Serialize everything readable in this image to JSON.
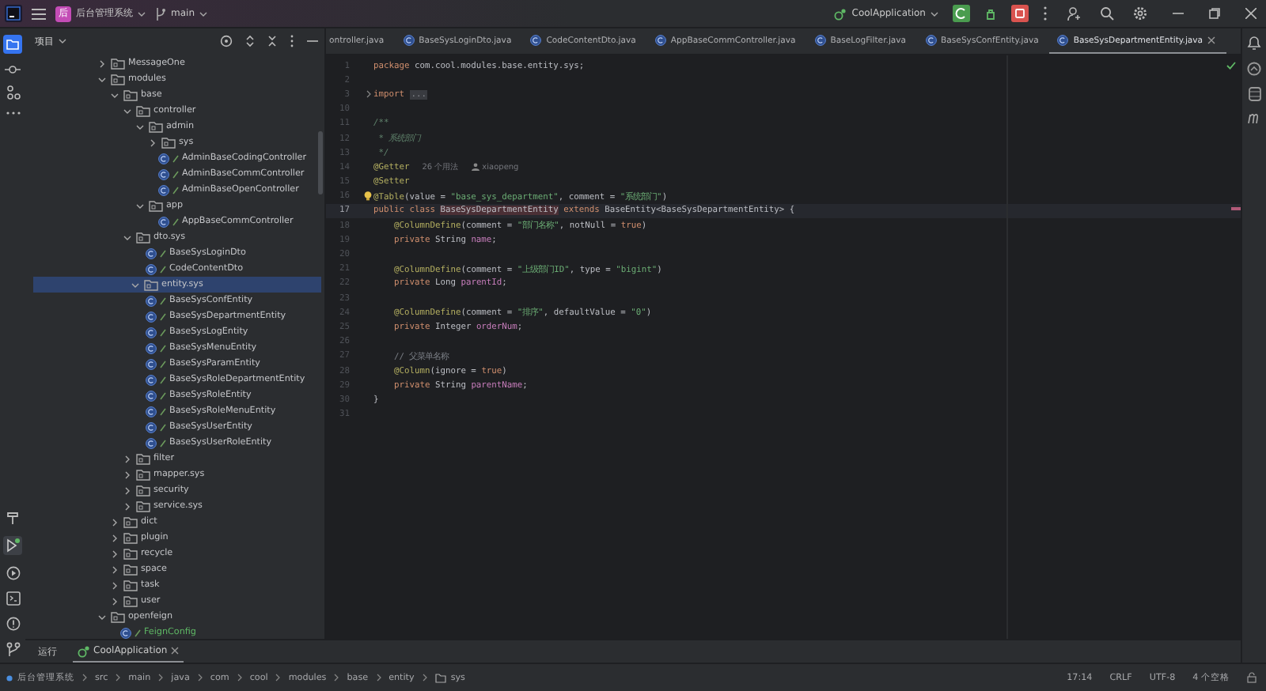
{
  "title_bar": {
    "project": "后台管理系统",
    "project_badge": "后",
    "branch": "main",
    "run_config": "CoolApplication"
  },
  "project_panel": {
    "title": "项目",
    "tree": [
      {
        "label": "MessageOne",
        "kind": "folder",
        "expanded": false,
        "selected": false
      },
      {
        "label": "modules",
        "kind": "folder",
        "expanded": true,
        "selected": false,
        "children": [
          {
            "label": "base",
            "kind": "folder",
            "expanded": true,
            "selected": false,
            "children": [
              {
                "label": "controller",
                "kind": "folder",
                "expanded": true,
                "selected": false,
                "children": [
                  {
                    "label": "admin",
                    "kind": "folder",
                    "expanded": true,
                    "selected": false,
                    "children": [
                      {
                        "label": "sys",
                        "kind": "folder",
                        "expanded": false,
                        "selected": false
                      },
                      {
                        "label": "AdminBaseCodingController",
                        "kind": "class",
                        "added": false,
                        "selected": false
                      },
                      {
                        "label": "AdminBaseCommController",
                        "kind": "class",
                        "added": false,
                        "selected": false
                      },
                      {
                        "label": "AdminBaseOpenController",
                        "kind": "class",
                        "added": false,
                        "selected": false
                      }
                    ]
                  },
                  {
                    "label": "app",
                    "kind": "folder",
                    "expanded": true,
                    "selected": false,
                    "children": [
                      {
                        "label": "AppBaseCommController",
                        "kind": "class",
                        "added": false,
                        "selected": false
                      }
                    ]
                  }
                ]
              },
              {
                "label": "dto.sys",
                "kind": "folder",
                "expanded": true,
                "selected": false,
                "children": [
                  {
                    "label": "BaseSysLoginDto",
                    "kind": "class",
                    "added": false,
                    "selected": false
                  },
                  {
                    "label": "CodeContentDto",
                    "kind": "class",
                    "added": false,
                    "selected": false
                  }
                ]
              },
              {
                "label": "entity.sys",
                "kind": "folder",
                "expanded": true,
                "selected": true,
                "children": [
                  {
                    "label": "BaseSysConfEntity",
                    "kind": "class",
                    "added": false,
                    "selected": false
                  },
                  {
                    "label": "BaseSysDepartmentEntity",
                    "kind": "class",
                    "added": false,
                    "selected": false
                  },
                  {
                    "label": "BaseSysLogEntity",
                    "kind": "class",
                    "added": false,
                    "selected": false
                  },
                  {
                    "label": "BaseSysMenuEntity",
                    "kind": "class",
                    "added": false,
                    "selected": false
                  },
                  {
                    "label": "BaseSysParamEntity",
                    "kind": "class",
                    "added": false,
                    "selected": false
                  },
                  {
                    "label": "BaseSysRoleDepartmentEntity",
                    "kind": "class",
                    "added": false,
                    "selected": false
                  },
                  {
                    "label": "BaseSysRoleEntity",
                    "kind": "class",
                    "added": false,
                    "selected": false
                  },
                  {
                    "label": "BaseSysRoleMenuEntity",
                    "kind": "class",
                    "added": false,
                    "selected": false
                  },
                  {
                    "label": "BaseSysUserEntity",
                    "kind": "class",
                    "added": false,
                    "selected": false
                  },
                  {
                    "label": "BaseSysUserRoleEntity",
                    "kind": "class",
                    "added": false,
                    "selected": false
                  }
                ]
              },
              {
                "label": "filter",
                "kind": "folder",
                "expanded": false,
                "selected": false
              },
              {
                "label": "mapper.sys",
                "kind": "folder",
                "expanded": false,
                "selected": false
              },
              {
                "label": "security",
                "kind": "folder",
                "expanded": false,
                "selected": false
              },
              {
                "label": "service.sys",
                "kind": "folder",
                "expanded": false,
                "selected": false
              }
            ]
          },
          {
            "label": "dict",
            "kind": "folder",
            "expanded": false,
            "selected": false
          },
          {
            "label": "plugin",
            "kind": "folder",
            "expanded": false,
            "selected": false
          },
          {
            "label": "recycle",
            "kind": "folder",
            "expanded": false,
            "selected": false
          },
          {
            "label": "space",
            "kind": "folder",
            "expanded": false,
            "selected": false
          },
          {
            "label": "task",
            "kind": "folder",
            "expanded": false,
            "selected": false
          },
          {
            "label": "user",
            "kind": "folder",
            "expanded": false,
            "selected": false
          }
        ]
      },
      {
        "label": "openfeign",
        "kind": "folder",
        "expanded": true,
        "selected": false,
        "children": [
          {
            "label": "FeignConfig",
            "kind": "class",
            "added": true,
            "selected": false
          }
        ]
      }
    ]
  },
  "editor_tabs": [
    {
      "label": "ontroller.java",
      "selected": false
    },
    {
      "label": "BaseSysLoginDto.java",
      "selected": false
    },
    {
      "label": "CodeContentDto.java",
      "selected": false
    },
    {
      "label": "AppBaseCommController.java",
      "selected": false
    },
    {
      "label": "BaseLogFilter.java",
      "selected": false
    },
    {
      "label": "BaseSysConfEntity.java",
      "selected": false
    },
    {
      "label": "BaseSysDepartmentEntity.java",
      "selected": true
    }
  ],
  "code": [
    {
      "number": "1",
      "current": false,
      "folded": false,
      "bulb": false,
      "indented": false,
      "tokens": [
        {
          "kind": "kw",
          "text": "package"
        },
        {
          "kind": "plain",
          "text": " com.cool.modules.base.entity.sys;"
        }
      ]
    },
    {
      "number": "2",
      "current": false,
      "folded": false,
      "bulb": false
    },
    {
      "number": "3",
      "current": false,
      "folded": true,
      "bulb": false,
      "indented": false,
      "tokens": [
        {
          "kind": "kw",
          "text": "import "
        },
        {
          "kind": "fold",
          "text": "..."
        }
      ]
    },
    {
      "number": "10",
      "current": false,
      "folded": false,
      "bulb": false
    },
    {
      "number": "11",
      "current": false,
      "folded": false,
      "bulb": false,
      "indented": false,
      "tokens": [
        {
          "kind": "doc",
          "text": "/**"
        }
      ]
    },
    {
      "number": "12",
      "current": false,
      "folded": false,
      "bulb": false,
      "indented": false,
      "tokens": [
        {
          "kind": "doc",
          "text": " * 系统部门"
        }
      ]
    },
    {
      "number": "13",
      "current": false,
      "folded": false,
      "bulb": false,
      "indented": false,
      "tokens": [
        {
          "kind": "doc",
          "text": " */"
        }
      ]
    },
    {
      "number": "14",
      "current": false,
      "folded": false,
      "bulb": false,
      "indented": false,
      "tokens": [
        {
          "kind": "ann",
          "text": "@Getter"
        }
      ],
      "hints": [
        {
          "kind": "usages",
          "text": "26 个用法"
        },
        {
          "kind": "author",
          "text": "xiaopeng"
        }
      ]
    },
    {
      "number": "15",
      "current": false,
      "folded": false,
      "bulb": false,
      "indented": false,
      "tokens": [
        {
          "kind": "ann",
          "text": "@Setter"
        }
      ]
    },
    {
      "number": "16",
      "current": false,
      "folded": false,
      "bulb": true,
      "indented": false,
      "tokens": [
        {
          "kind": "ann",
          "text": "@Table"
        },
        {
          "kind": "plain",
          "text": "(value = "
        },
        {
          "kind": "str",
          "text": "\"base_sys_department\""
        },
        {
          "kind": "plain",
          "text": ", comment = "
        },
        {
          "kind": "str",
          "text": "\"系统部门\""
        },
        {
          "kind": "plain",
          "text": ")"
        }
      ]
    },
    {
      "number": "17",
      "current": true,
      "folded": false,
      "bulb": false,
      "indented": false,
      "tokens": [
        {
          "kind": "kw",
          "text": "public class "
        },
        {
          "kind": "hl",
          "text": "BaseSysDepartmentEntity"
        },
        {
          "kind": "kw",
          "text": " extends "
        },
        {
          "kind": "plain",
          "text": "BaseEntity<BaseSysDepartmentEntity> {"
        }
      ]
    },
    {
      "number": "18",
      "current": false,
      "folded": false,
      "bulb": false,
      "indented": true,
      "tokens": [
        {
          "kind": "ann",
          "text": "@ColumnDefine"
        },
        {
          "kind": "plain",
          "text": "(comment = "
        },
        {
          "kind": "str",
          "text": "\"部门名称\""
        },
        {
          "kind": "plain",
          "text": ", notNull = "
        },
        {
          "kind": "kw",
          "text": "true"
        },
        {
          "kind": "plain",
          "text": ")"
        }
      ]
    },
    {
      "number": "19",
      "current": false,
      "folded": false,
      "bulb": false,
      "indented": true,
      "tokens": [
        {
          "kind": "kw",
          "text": "private "
        },
        {
          "kind": "plain",
          "text": "String "
        },
        {
          "kind": "field",
          "text": "name"
        },
        {
          "kind": "plain",
          "text": ";"
        }
      ]
    },
    {
      "number": "20",
      "current": false,
      "folded": false,
      "bulb": false
    },
    {
      "number": "21",
      "current": false,
      "folded": false,
      "bulb": false,
      "indented": true,
      "tokens": [
        {
          "kind": "ann",
          "text": "@ColumnDefine"
        },
        {
          "kind": "plain",
          "text": "(comment = "
        },
        {
          "kind": "str",
          "text": "\"上级部门ID\""
        },
        {
          "kind": "plain",
          "text": ", type = "
        },
        {
          "kind": "str",
          "text": "\"bigint\""
        },
        {
          "kind": "plain",
          "text": ")"
        }
      ]
    },
    {
      "number": "22",
      "current": false,
      "folded": false,
      "bulb": false,
      "indented": true,
      "tokens": [
        {
          "kind": "kw",
          "text": "private "
        },
        {
          "kind": "plain",
          "text": "Long "
        },
        {
          "kind": "field",
          "text": "parentId"
        },
        {
          "kind": "plain",
          "text": ";"
        }
      ]
    },
    {
      "number": "23",
      "current": false,
      "folded": false,
      "bulb": false
    },
    {
      "number": "24",
      "current": false,
      "folded": false,
      "bulb": false,
      "indented": true,
      "tokens": [
        {
          "kind": "ann",
          "text": "@ColumnDefine"
        },
        {
          "kind": "plain",
          "text": "(comment = "
        },
        {
          "kind": "str",
          "text": "\"排序\""
        },
        {
          "kind": "plain",
          "text": ", defaultValue = "
        },
        {
          "kind": "str",
          "text": "\"0\""
        },
        {
          "kind": "plain",
          "text": ")"
        }
      ]
    },
    {
      "number": "25",
      "current": false,
      "folded": false,
      "bulb": false,
      "indented": true,
      "tokens": [
        {
          "kind": "kw",
          "text": "private "
        },
        {
          "kind": "plain",
          "text": "Integer "
        },
        {
          "kind": "field",
          "text": "orderNum"
        },
        {
          "kind": "plain",
          "text": ";"
        }
      ]
    },
    {
      "number": "26",
      "current": false,
      "folded": false,
      "bulb": false
    },
    {
      "number": "27",
      "current": false,
      "folded": false,
      "bulb": false,
      "indented": true,
      "tokens": [
        {
          "kind": "cmt",
          "text": "// 父菜单名称"
        }
      ]
    },
    {
      "number": "28",
      "current": false,
      "folded": false,
      "bulb": false,
      "indented": true,
      "tokens": [
        {
          "kind": "ann",
          "text": "@Column"
        },
        {
          "kind": "plain",
          "text": "(ignore = "
        },
        {
          "kind": "kw",
          "text": "true"
        },
        {
          "kind": "plain",
          "text": ")"
        }
      ]
    },
    {
      "number": "29",
      "current": false,
      "folded": false,
      "bulb": false,
      "indented": true,
      "tokens": [
        {
          "kind": "kw",
          "text": "private "
        },
        {
          "kind": "plain",
          "text": "String "
        },
        {
          "kind": "field",
          "text": "parentName"
        },
        {
          "kind": "plain",
          "text": ";"
        }
      ]
    },
    {
      "number": "30",
      "current": false,
      "folded": false,
      "bulb": false,
      "indented": false,
      "tokens": [
        {
          "kind": "plain",
          "text": "}"
        }
      ]
    },
    {
      "number": "31",
      "current": false,
      "folded": false,
      "bulb": false
    }
  ],
  "run_bar": {
    "label": "运行",
    "tab": "CoolApplication"
  },
  "status_bar": {
    "breadcrumbs": [
      "后台管理系统",
      "src",
      "main",
      "java",
      "com",
      "cool",
      "modules",
      "base",
      "entity",
      "sys"
    ],
    "items": [
      "17:14",
      "CRLF",
      "UTF-8",
      "4 个空格"
    ]
  }
}
